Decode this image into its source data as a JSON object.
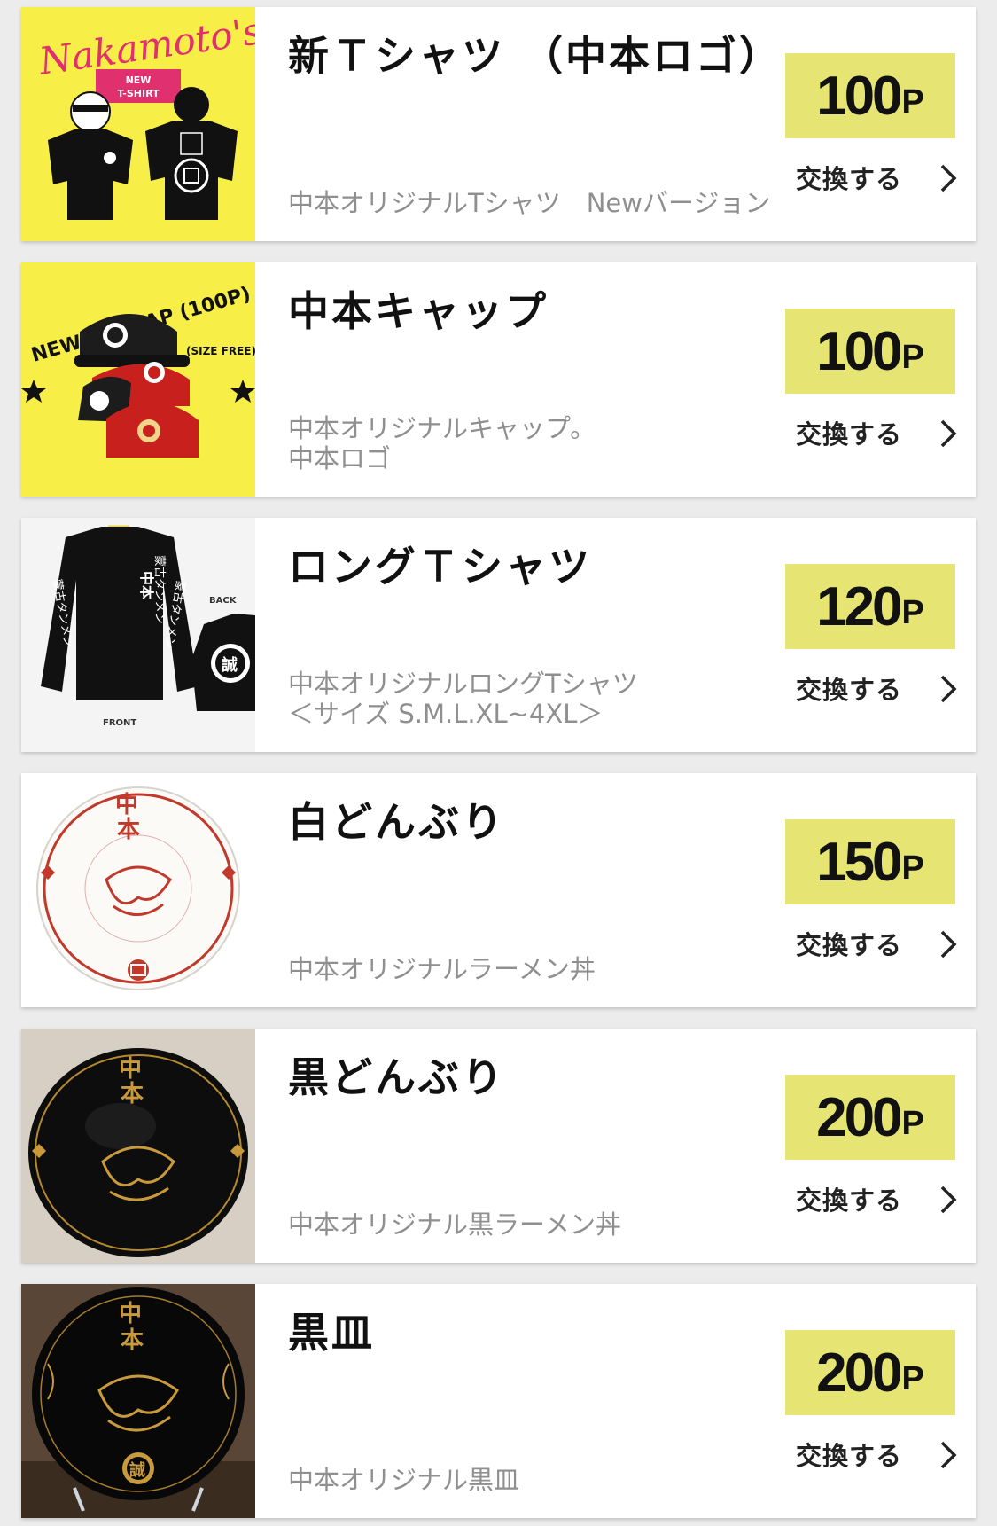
{
  "theme": {
    "price_bg": "#e6e573",
    "card_bg": "#ffffff",
    "page_bg": "#ececec",
    "muted_text": "#8f8f8f"
  },
  "exchange_label": "交換する",
  "items": [
    {
      "title": "新Ｔシャツ （中本ロゴ）",
      "description": "中本オリジナルTシャツ　Newバージョン",
      "price": "100",
      "unit": "P",
      "image": {
        "kind": "tshirt-new",
        "bg": "#f7ee48",
        "text_top": "Nakamoto's",
        "badge": "NEW\nT-SHIRT"
      }
    },
    {
      "title": "中本キャップ",
      "description": "中本オリジナルキャップ。\n中本ロゴ",
      "price": "100",
      "unit": "P",
      "image": {
        "kind": "cap",
        "bg": "#f7ee48",
        "text_top": "NEW 中本 CAP (100P)",
        "text_side": "(SIZE FREE)"
      }
    },
    {
      "title": "ロングＴシャツ",
      "description": "中本オリジナルロングTシャツ\n＜サイズ S.M.L.XL~4XL＞",
      "price": "120",
      "unit": "P",
      "image": {
        "kind": "long-tshirt",
        "bg": "#f4f4f4",
        "label_back": "BACK",
        "label_front": "FRONT"
      }
    },
    {
      "title": "白どんぶり",
      "description": "中本オリジナルラーメン丼",
      "price": "150",
      "unit": "P",
      "image": {
        "kind": "white-bowl",
        "bg": "#ffffff"
      }
    },
    {
      "title": "黒どんぶり",
      "description": "中本オリジナル黒ラーメン丼",
      "price": "200",
      "unit": "P",
      "image": {
        "kind": "black-bowl",
        "bg": "#d8cfc4"
      }
    },
    {
      "title": "黒皿",
      "description": "中本オリジナル黒皿",
      "price": "200",
      "unit": "P",
      "image": {
        "kind": "black-plate",
        "bg": "#5a4636"
      }
    }
  ]
}
